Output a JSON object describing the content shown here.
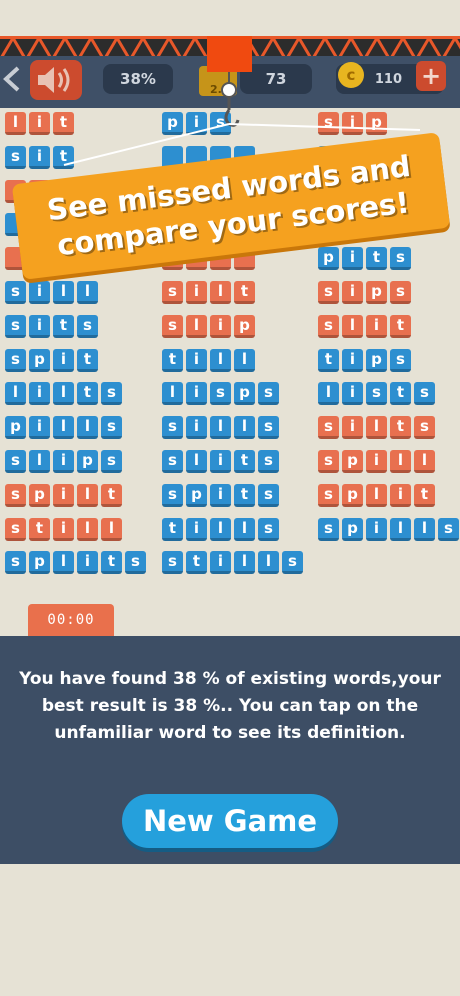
{
  "hud": {
    "percent": "38%",
    "level_label": "2..",
    "level_value": "73",
    "coin_symbol": "c",
    "coins": "110",
    "plus": "+"
  },
  "banner": {
    "line1": "See missed words and",
    "line2": "compare your scores!"
  },
  "columns": [
    [
      {
        "word": "lit",
        "status": "missed"
      },
      {
        "word": "sit",
        "status": "found"
      },
      {
        "word": "",
        "status": "missed"
      },
      {
        "word": "",
        "status": "found"
      },
      {
        "word": "",
        "status": "missed"
      },
      {
        "word": "sill",
        "status": "found"
      },
      {
        "word": "sits",
        "status": "found"
      },
      {
        "word": "spit",
        "status": "found"
      },
      {
        "word": "lilts",
        "status": "found"
      },
      {
        "word": "pills",
        "status": "found"
      },
      {
        "word": "slips",
        "status": "found"
      },
      {
        "word": "spilt",
        "status": "missed"
      },
      {
        "word": "still",
        "status": "missed"
      },
      {
        "word": "splits",
        "status": "found"
      }
    ],
    [
      {
        "word": "pis",
        "status": "found"
      },
      {
        "word": "",
        "status": "found"
      },
      {
        "word": "",
        "status": "found"
      },
      {
        "word": "",
        "status": "found"
      },
      {
        "word": "",
        "status": "missed"
      },
      {
        "word": "silt",
        "status": "missed"
      },
      {
        "word": "slip",
        "status": "missed"
      },
      {
        "word": "till",
        "status": "found"
      },
      {
        "word": "lisps",
        "status": "found"
      },
      {
        "word": "sills",
        "status": "found"
      },
      {
        "word": "slits",
        "status": "found"
      },
      {
        "word": "spits",
        "status": "found"
      },
      {
        "word": "tills",
        "status": "found"
      },
      {
        "word": "stills",
        "status": "found"
      }
    ],
    [
      {
        "word": "sip",
        "status": "missed"
      },
      {
        "word": "",
        "status": "found"
      },
      {
        "word": "",
        "status": "missed"
      },
      {
        "word": "",
        "status": "found"
      },
      {
        "word": "pits",
        "status": "found"
      },
      {
        "word": "sips",
        "status": "missed"
      },
      {
        "word": "slit",
        "status": "missed"
      },
      {
        "word": "tips",
        "status": "found"
      },
      {
        "word": "lists",
        "status": "found"
      },
      {
        "word": "silts",
        "status": "missed"
      },
      {
        "word": "spill",
        "status": "missed"
      },
      {
        "word": "split",
        "status": "missed"
      },
      {
        "word": "spills",
        "status": "found"
      }
    ]
  ],
  "timer": "00:00",
  "result": {
    "message": "You have found 38 % of existing words,your best result is 38 %.. You can tap on the unfamiliar word to see its definition."
  },
  "buttons": {
    "new_game": "New Game"
  }
}
